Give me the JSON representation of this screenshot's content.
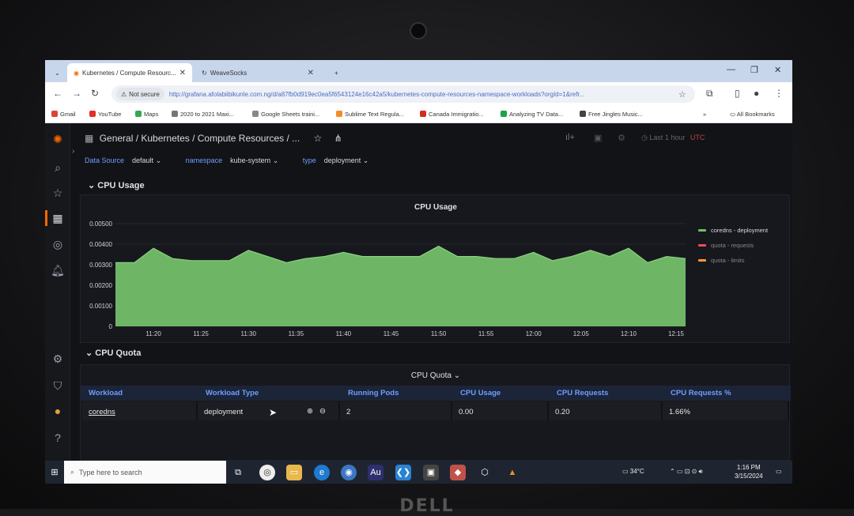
{
  "browser": {
    "tabs": [
      {
        "label": "Kubernetes / Compute Resourc..."
      },
      {
        "label": "WeaveSocks"
      }
    ],
    "new_tab": "+",
    "not_secure": "Not secure",
    "url": "http://grafana.afolabiibikunle.com.ng/d/a87fb0d919ec0ea5f6543124e16c42a5/kubernetes-compute-resources-namespace-workloads?orgId=1&refr...",
    "bookmarks": [
      {
        "label": "Gmail",
        "color": "#db4437"
      },
      {
        "label": "YouTube",
        "color": "#e52d27"
      },
      {
        "label": "Maps",
        "color": "#34a853"
      },
      {
        "label": "2020 to 2021 Maxi...",
        "color": "#777777"
      },
      {
        "label": "Google Sheets traini...",
        "color": "#888888"
      },
      {
        "label": "Sublime Text Regula...",
        "color": "#f28c28"
      },
      {
        "label": "Canada Immigratio...",
        "color": "#d52b1e"
      },
      {
        "label": "Analyzing TV Data...",
        "color": "#1aa34a"
      },
      {
        "label": "Free Jingles Music...",
        "color": "#444444"
      }
    ],
    "all_bookmarks": "All Bookmarks"
  },
  "grafana": {
    "breadcrumb": "General  / Kubernetes / Compute Resources / ...",
    "time_range": "Last 1 hour",
    "timezone": "UTC",
    "variables": [
      {
        "label": "Data Source",
        "value": "default"
      },
      {
        "label": "namespace",
        "value": "kube-system"
      },
      {
        "label": "type",
        "value": "deployment"
      }
    ],
    "row1_title": "CPU Usage",
    "row2_title": "CPU Quota",
    "table": {
      "title": "CPU Quota",
      "headers": [
        "Workload",
        "Workload Type",
        "Running Pods",
        "CPU Usage",
        "CPU Requests",
        "CPU Requests %"
      ],
      "rows": [
        [
          "coredns",
          "deployment",
          "2",
          "0.00",
          "0.20",
          "1.66%"
        ]
      ]
    }
  },
  "chart_data": {
    "type": "area",
    "title": "CPU Usage",
    "x": [
      "11:16",
      "11:18",
      "11:20",
      "11:22",
      "11:24",
      "11:26",
      "11:28",
      "11:30",
      "11:32",
      "11:34",
      "11:36",
      "11:38",
      "11:40",
      "11:42",
      "11:44",
      "11:46",
      "11:48",
      "11:50",
      "11:52",
      "11:54",
      "11:56",
      "11:58",
      "12:00",
      "12:02",
      "12:04",
      "12:06",
      "12:08",
      "12:10",
      "12:12",
      "12:14",
      "12:16"
    ],
    "xticks": [
      "11:20",
      "11:25",
      "11:30",
      "11:35",
      "11:40",
      "11:45",
      "11:50",
      "11:55",
      "12:00",
      "12:05",
      "12:10",
      "12:15"
    ],
    "yticks": [
      "0",
      "0.00100",
      "0.00200",
      "0.00300",
      "0.00400",
      "0.00500"
    ],
    "ylim": [
      0,
      0.005
    ],
    "series": [
      {
        "name": "coredns - deployment",
        "color": "#73bf69",
        "values": [
          0.0031,
          0.0031,
          0.0038,
          0.0033,
          0.0032,
          0.0032,
          0.0032,
          0.0037,
          0.0034,
          0.0031,
          0.0033,
          0.0034,
          0.0036,
          0.0034,
          0.0034,
          0.0034,
          0.0034,
          0.0039,
          0.0034,
          0.0034,
          0.0033,
          0.0033,
          0.0036,
          0.0032,
          0.0034,
          0.0037,
          0.0034,
          0.0038,
          0.0031,
          0.0034,
          0.0033
        ]
      },
      {
        "name": "quota - requests",
        "color": "#f2495c",
        "values": []
      },
      {
        "name": "quota - limits",
        "color": "#ff9830",
        "values": []
      }
    ],
    "legend": "right"
  },
  "taskbar": {
    "search_placeholder": "Type here to search",
    "temperature": "34°C",
    "time": "1:16 PM",
    "date": "3/15/2024"
  }
}
